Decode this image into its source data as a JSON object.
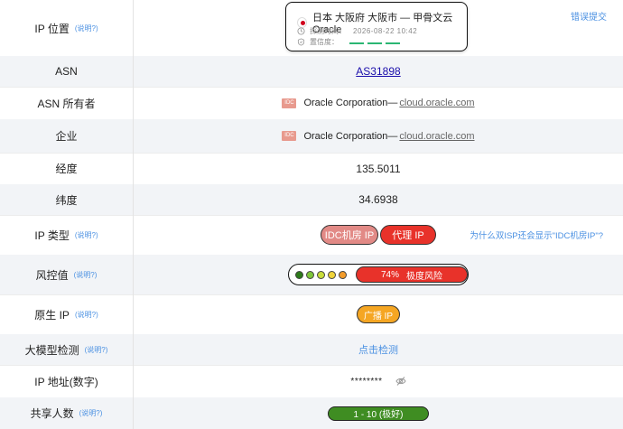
{
  "help_text": "(说明?)",
  "location": {
    "label": "IP 位置",
    "title": "日本 大阪府 大阪市 — 甲骨文云 Oracle",
    "detected_label": "探测时间：",
    "detected_time": "2026-08-22 10:42",
    "confidence_label": "置信度：",
    "report_link": "错误提交"
  },
  "asn": {
    "label": "ASN",
    "value": "AS31898"
  },
  "asn_owner": {
    "label": "ASN 所有者",
    "badge": "IDC",
    "org": "Oracle Corporation—",
    "domain": "cloud.oracle.com"
  },
  "enterprise": {
    "label": "企业",
    "badge": "IDC",
    "org": "Oracle Corporation—",
    "domain": "cloud.oracle.com"
  },
  "longitude": {
    "label": "经度",
    "value": "135.5011"
  },
  "latitude": {
    "label": "纬度",
    "value": "34.6938"
  },
  "ip_type": {
    "label": "IP 类型",
    "tag1": "IDC机房 IP",
    "tag2": "代理 IP",
    "why_link": "为什么双ISP还会显示\"IDC机房IP\"?"
  },
  "risk": {
    "label": "风控值",
    "score": "74%",
    "level": "极度风险",
    "dot_colors": [
      "#2d7a1a",
      "#7ec53a",
      "#c9dd3b",
      "#f0d43a",
      "#f39c2a"
    ],
    "value": 0.74
  },
  "native_ip": {
    "label": "原生 IP",
    "value": "广播 IP"
  },
  "llm_check": {
    "label": "大模型检测",
    "link": "点击检测"
  },
  "ip_numeric": {
    "label": "IP 地址(数字)",
    "value": "********"
  },
  "shared_users": {
    "label": "共享人数",
    "value": "1 - 10 (极好)"
  },
  "colors": {
    "accent_link": "#4a90e2",
    "danger": "#e8322a",
    "warning": "#f5a623",
    "success": "#3f8d22"
  }
}
